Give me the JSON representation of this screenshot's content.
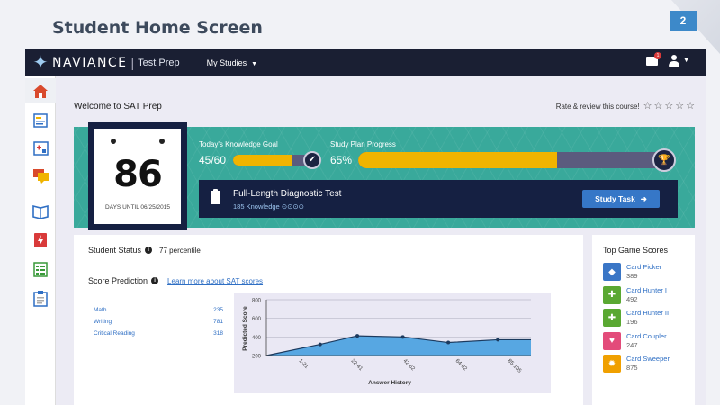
{
  "slide": {
    "title": "Student Home Screen",
    "number": "2"
  },
  "topbar": {
    "logo_text": "NAVIANCE",
    "logo_sub": "Test Prep",
    "menu_label": "My Studies",
    "mail_badge": "1"
  },
  "sidebar": {
    "items": [
      {
        "icon": "home-icon",
        "color": "#d94a2c"
      },
      {
        "icon": "notepad-icon",
        "color": "#2f6fc4"
      },
      {
        "icon": "medical-kit-icon",
        "color": "#2f6fc4"
      },
      {
        "icon": "chat-icon",
        "color": "#f0b400"
      },
      {
        "icon": "book-icon",
        "color": "#2f6fc4"
      },
      {
        "icon": "flash-card-icon",
        "color": "#d93a3a"
      },
      {
        "icon": "checklist-icon",
        "color": "#3a9a3a"
      },
      {
        "icon": "clipboard-icon",
        "color": "#2f6fc4"
      }
    ]
  },
  "main": {
    "welcome": "Welcome to SAT Prep",
    "rate_label": "Rate & review this course!",
    "star_count": 5
  },
  "banner": {
    "days": "86",
    "days_label": "DAYS UNTIL 06/25/2015",
    "goal_label": "Today's Knowledge Goal",
    "goal_value": "45/60",
    "goal_fraction": 0.75,
    "plan_label": "Study Plan Progress",
    "plan_value": "65%",
    "plan_fraction": 0.65,
    "diag_title": "Full-Length Diagnostic Test",
    "diag_sub": "185 Knowledge",
    "study_button": "Study Task"
  },
  "status": {
    "label": "Student Status",
    "value": "77 percentile"
  },
  "prediction": {
    "label": "Score Prediction",
    "link": "Learn more about SAT scores",
    "scores": [
      {
        "subject": "Math",
        "score": "235"
      },
      {
        "subject": "Writing",
        "score": "781"
      },
      {
        "subject": "Critical Reading",
        "score": "318"
      }
    ]
  },
  "chart_data": {
    "type": "area",
    "xlabel": "Answer History",
    "ylabel": "Predicted Score",
    "ylim": [
      200,
      600
    ],
    "yticks": [
      200,
      400,
      600,
      800
    ],
    "x": [
      "1-21",
      "22-41",
      "42-62",
      "64-82",
      "85-105"
    ],
    "points": [
      {
        "x": 0,
        "y": 200
      },
      {
        "x": 1.3,
        "y": 320
      },
      {
        "x": 2.2,
        "y": 412
      },
      {
        "x": 3.3,
        "y": 400
      },
      {
        "x": 4.4,
        "y": 340
      },
      {
        "x": 5.6,
        "y": 370
      },
      {
        "x": 6.4,
        "y": 370
      }
    ],
    "fill_color": "#4fa3e0",
    "line_color": "#1c3a5e",
    "grid": true
  },
  "games": {
    "title": "Top Game Scores",
    "items": [
      {
        "name": "Card Picker",
        "score": "389",
        "color": "#3a76c6",
        "icon": "card-picker-icon",
        "glyph": "◆"
      },
      {
        "name": "Card Hunter I",
        "score": "492",
        "color": "#5aa832",
        "icon": "card-hunter-i-icon",
        "glyph": "✚"
      },
      {
        "name": "Card Hunter II",
        "score": "196",
        "color": "#5aa832",
        "icon": "card-hunter-ii-icon",
        "glyph": "✚"
      },
      {
        "name": "Card Coupler",
        "score": "247",
        "color": "#e34b7a",
        "icon": "card-coupler-icon",
        "glyph": "♥"
      },
      {
        "name": "Card Sweeper",
        "score": "875",
        "color": "#f0a000",
        "icon": "card-sweeper-icon",
        "glyph": "✹"
      }
    ]
  }
}
